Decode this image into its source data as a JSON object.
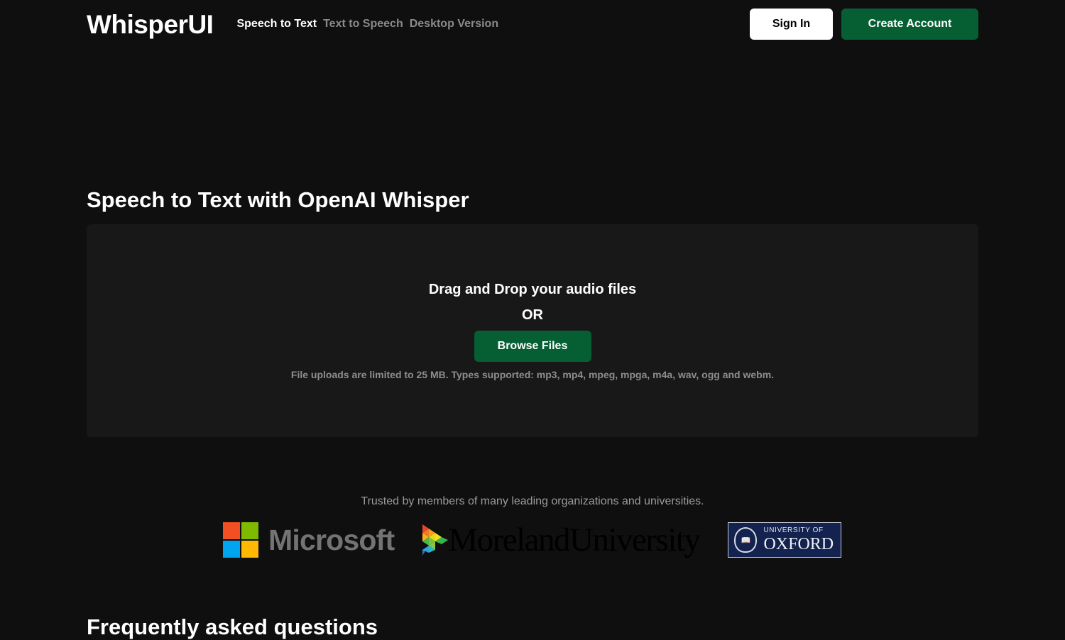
{
  "header": {
    "logo": "WhisperUI",
    "nav": [
      {
        "label": "Speech to Text",
        "active": true
      },
      {
        "label": "Text to Speech",
        "active": false
      },
      {
        "label": "Desktop Version",
        "active": false
      }
    ],
    "sign_in_label": "Sign In",
    "create_account_label": "Create Account"
  },
  "main": {
    "title": "Speech to Text with OpenAI Whisper",
    "dropzone": {
      "title": "Drag and Drop your audio files",
      "or_label": "OR",
      "browse_label": "Browse Files",
      "note": "File uploads are limited to 25 MB. Types supported: mp3, mp4, mpeg, mpga, m4a, wav, ogg and webm."
    }
  },
  "trusted": {
    "text": "Trusted by members of many leading organizations and universities.",
    "logos": {
      "microsoft": "Microsoft",
      "moreland": "MorelandUniversity",
      "oxford_small": "UNIVERSITY OF",
      "oxford_big": "OXFORD"
    }
  },
  "faq": {
    "title": "Frequently asked questions"
  },
  "colors": {
    "background": "#0f0f0f",
    "panel": "#181818",
    "accent_green": "#065f33",
    "muted_text": "#8a8a8a",
    "oxford_blue": "#13224f"
  }
}
